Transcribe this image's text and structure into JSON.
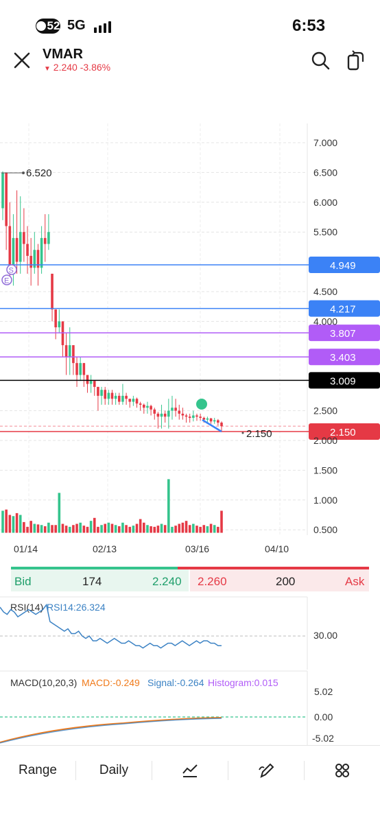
{
  "status_bar": {
    "badge": "52",
    "network": "5G",
    "time": "6:53"
  },
  "header": {
    "ticker": "VMAR",
    "arrow": "▼",
    "price": "2.240",
    "change": "-3.86%"
  },
  "price_axis": {
    "ticks": [
      "7.000",
      "6.500",
      "6.000",
      "5.500",
      "4.500",
      "4.000",
      "2.500",
      "2.000",
      "1.500",
      "1.000",
      "0.500"
    ],
    "tick_values": [
      7.0,
      6.5,
      6.0,
      5.5,
      4.5,
      4.0,
      2.5,
      2.0,
      1.5,
      1.0,
      0.5
    ]
  },
  "date_axis": {
    "labels": [
      "01/14",
      "02/13",
      "03/16",
      "04/10"
    ]
  },
  "annotations": {
    "high_label": "6.520",
    "low_label": "2.150",
    "marker_s": "S",
    "marker_e": "E"
  },
  "levels": [
    {
      "value": "4.949",
      "color": "#3b82f6",
      "text_color": "#ffffff"
    },
    {
      "value": "4.217",
      "color": "#3b82f6",
      "text_color": "#ffffff"
    },
    {
      "value": "3.807",
      "color": "#b15cf7",
      "text_color": "#ffffff"
    },
    {
      "value": "3.403",
      "color": "#b15cf7",
      "text_color": "#ffffff"
    },
    {
      "value": "3.009",
      "color": "#000000",
      "text_color": "#ffffff"
    },
    {
      "value": "2.150",
      "color": "#e53945",
      "text_color": "#ffffff"
    }
  ],
  "chart_data": [
    {
      "type": "candlestick",
      "title": "VMAR Daily",
      "ylim": [
        0.35,
        7.1
      ],
      "candles": [
        [
          5.9,
          6.5,
          6.52,
          5.7
        ],
        [
          6.5,
          5.6,
          6.5,
          5.2
        ],
        [
          5.6,
          4.9,
          6.0,
          4.7
        ],
        [
          4.9,
          5.4,
          5.8,
          4.6
        ],
        [
          5.4,
          5.0,
          6.2,
          4.8
        ],
        [
          5.0,
          5.5,
          6.1,
          4.8
        ],
        [
          5.5,
          5.3,
          5.9,
          5.0
        ],
        [
          5.3,
          5.1,
          5.6,
          4.8
        ],
        [
          5.1,
          4.9,
          5.4,
          4.6
        ],
        [
          4.9,
          5.2,
          5.5,
          4.8
        ],
        [
          5.2,
          4.9,
          5.3,
          4.6
        ],
        [
          4.9,
          5.4,
          5.6,
          4.8
        ],
        [
          5.4,
          5.3,
          5.8,
          5.0
        ],
        [
          5.3,
          5.5,
          5.8,
          5.2
        ],
        [
          4.8,
          4.2,
          4.8,
          4.0
        ],
        [
          4.2,
          3.9,
          4.2,
          3.7
        ],
        [
          3.9,
          4.0,
          4.2,
          3.8
        ],
        [
          4.0,
          3.6,
          4.0,
          3.4
        ],
        [
          3.6,
          3.4,
          3.8,
          3.1
        ],
        [
          3.4,
          3.6,
          3.9,
          3.1
        ],
        [
          3.6,
          3.3,
          3.6,
          3.1
        ],
        [
          3.3,
          3.1,
          3.4,
          2.9
        ],
        [
          3.1,
          3.3,
          3.4,
          3.0
        ],
        [
          3.3,
          3.1,
          3.3,
          2.9
        ],
        [
          3.1,
          2.95,
          3.1,
          2.8
        ],
        [
          2.95,
          3.0,
          3.1,
          2.8
        ],
        [
          3.0,
          2.9,
          3.0,
          2.75
        ],
        [
          2.9,
          2.75,
          2.9,
          2.5
        ],
        [
          2.75,
          2.85,
          2.9,
          2.6
        ],
        [
          2.85,
          2.7,
          2.9,
          2.6
        ],
        [
          2.7,
          2.8,
          2.85,
          2.6
        ],
        [
          2.8,
          2.7,
          2.85,
          2.6
        ],
        [
          2.7,
          2.75,
          2.8,
          2.6
        ],
        [
          2.75,
          2.65,
          2.8,
          2.6
        ],
        [
          2.65,
          2.75,
          2.95,
          2.6
        ],
        [
          2.75,
          2.7,
          2.8,
          2.6
        ],
        [
          2.7,
          2.65,
          2.7,
          2.55
        ],
        [
          2.65,
          2.7,
          2.75,
          2.58
        ],
        [
          2.7,
          2.62,
          2.72,
          2.55
        ],
        [
          2.62,
          2.6,
          2.65,
          2.5
        ],
        [
          2.6,
          2.55,
          2.62,
          2.45
        ],
        [
          2.55,
          2.58,
          2.65,
          2.45
        ],
        [
          2.58,
          2.52,
          2.6,
          2.42
        ],
        [
          2.52,
          2.45,
          2.55,
          2.35
        ],
        [
          2.45,
          2.4,
          2.48,
          2.2
        ],
        [
          2.4,
          2.45,
          2.6,
          2.2
        ],
        [
          2.45,
          2.4,
          2.5,
          2.3
        ],
        [
          2.4,
          2.5,
          2.7,
          2.2
        ],
        [
          2.5,
          2.55,
          2.75,
          2.35
        ],
        [
          2.55,
          2.5,
          2.7,
          2.4
        ],
        [
          2.5,
          2.45,
          2.6,
          2.35
        ],
        [
          2.45,
          2.42,
          2.55,
          2.35
        ],
        [
          2.42,
          2.4,
          2.45,
          2.3
        ],
        [
          2.4,
          2.38,
          2.45,
          2.3
        ],
        [
          2.38,
          2.42,
          2.5,
          2.32
        ],
        [
          2.42,
          2.4,
          2.45,
          2.33
        ],
        [
          2.4,
          2.38,
          2.45,
          2.33
        ],
        [
          2.38,
          2.35,
          2.4,
          2.3
        ],
        [
          2.35,
          2.37,
          2.4,
          2.3
        ],
        [
          2.37,
          2.32,
          2.38,
          2.28
        ],
        [
          2.32,
          2.34,
          2.38,
          2.28
        ],
        [
          2.34,
          2.3,
          2.36,
          2.25
        ],
        [
          2.3,
          2.24,
          2.32,
          2.15
        ]
      ],
      "volume": [
        0.82,
        0.84,
        0.75,
        0.73,
        0.78,
        0.75,
        0.63,
        0.55,
        0.65,
        0.6,
        0.59,
        0.58,
        0.56,
        0.62,
        0.58,
        0.58,
        1.12,
        0.6,
        0.57,
        0.55,
        0.58,
        0.6,
        0.62,
        0.57,
        0.55,
        0.65,
        0.7,
        0.55,
        0.58,
        0.6,
        0.62,
        0.6,
        0.58,
        0.56,
        0.62,
        0.58,
        0.55,
        0.57,
        0.6,
        0.68,
        0.62,
        0.58,
        0.56,
        0.55,
        0.57,
        0.6,
        0.58,
        1.35,
        0.55,
        0.57,
        0.6,
        0.62,
        0.65,
        0.58,
        0.6,
        0.57,
        0.55,
        0.58,
        0.56,
        0.6,
        0.58,
        0.55,
        0.82
      ]
    },
    {
      "type": "line",
      "title": "RSI(14)",
      "series": [
        {
          "name": "RSI14:26.324",
          "values": [
            42,
            40,
            39,
            41,
            40,
            38,
            39,
            40,
            41,
            40,
            39,
            40,
            41,
            43,
            36,
            35,
            34,
            33,
            32,
            33,
            31,
            31,
            32,
            30,
            29,
            30,
            28,
            28,
            29,
            28,
            27,
            28,
            29,
            28,
            27,
            27,
            28,
            27,
            26,
            26,
            25,
            26,
            27,
            26,
            26,
            25,
            26,
            27,
            27,
            26,
            27,
            28,
            27,
            26,
            27,
            28,
            27,
            28,
            28,
            27,
            27,
            26,
            26
          ]
        }
      ],
      "ticks": [
        "30.00"
      ]
    },
    {
      "type": "line",
      "title": "MACD(10,20,3)",
      "series": [
        {
          "name": "MACD:-0.249",
          "color": "#f07a1a"
        },
        {
          "name": "Signal:-0.264",
          "color": "#3b82c4"
        },
        {
          "name": "Histogram:0.015",
          "color": "#b15cf7"
        }
      ],
      "ticks": [
        "5.02",
        "0.00",
        "-5.02"
      ]
    }
  ],
  "rsi": {
    "title": "RSI(14)",
    "value_label": "RSI14:26.324",
    "tick": "30.00"
  },
  "macd": {
    "title": "MACD(10,20,3)",
    "macd_label": "MACD:-0.249",
    "signal_label": "Signal:-0.264",
    "hist_label": "Histogram:0.015",
    "ticks": [
      "5.02",
      "0.00",
      "-5.02"
    ]
  },
  "bid_ask": {
    "bid_label": "Bid",
    "bid_size": "174",
    "bid_price": "2.240",
    "ask_price": "2.260",
    "ask_size": "200",
    "ask_label": "Ask"
  },
  "tabbar": {
    "range": "Range",
    "interval": "Daily"
  },
  "colors": {
    "up": "#35c48d",
    "down": "#e53945",
    "grid": "#d9d9d9",
    "text": "#333333"
  }
}
